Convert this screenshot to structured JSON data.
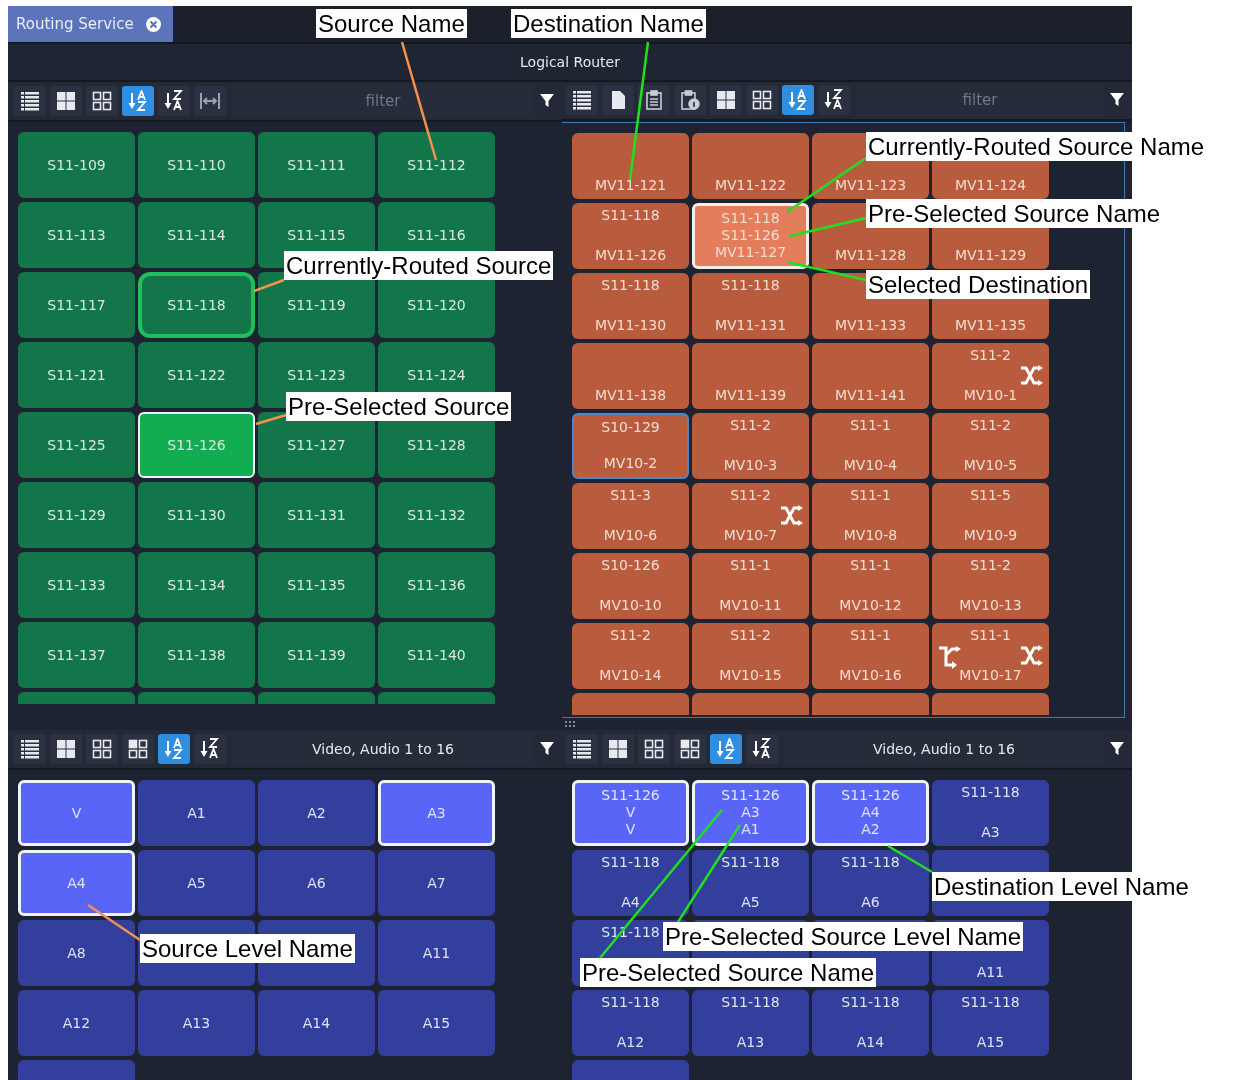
{
  "tab": {
    "label": "Routing Service",
    "selected": true
  },
  "header": {
    "title": "Logical Router"
  },
  "source_panel": {
    "toolbar": {
      "buttons": [
        {
          "kind": "list",
          "selected": false
        },
        {
          "kind": "grid-large",
          "selected": false
        },
        {
          "kind": "grid-small",
          "selected": false
        },
        {
          "kind": "sort-az",
          "selected": true
        },
        {
          "kind": "sort-za",
          "selected": false
        },
        {
          "kind": "fit-width",
          "selected": false
        }
      ],
      "filter": {
        "placeholder": "filter"
      }
    },
    "tiles": [
      {
        "name": "S11-109",
        "routed": false,
        "selected": false
      },
      {
        "name": "S11-110",
        "routed": false,
        "selected": false
      },
      {
        "name": "S11-111",
        "routed": false,
        "selected": false
      },
      {
        "name": "S11-112",
        "routed": false,
        "selected": false
      },
      {
        "name": "S11-113",
        "routed": false,
        "selected": false
      },
      {
        "name": "S11-114",
        "routed": false,
        "selected": false
      },
      {
        "name": "S11-115",
        "routed": false,
        "selected": false
      },
      {
        "name": "S11-116",
        "routed": false,
        "selected": false
      },
      {
        "name": "S11-117",
        "routed": false,
        "selected": false
      },
      {
        "name": "S11-118",
        "routed": true,
        "selected": false
      },
      {
        "name": "S11-119",
        "routed": false,
        "selected": false
      },
      {
        "name": "S11-120",
        "routed": false,
        "selected": false
      },
      {
        "name": "S11-121",
        "routed": false,
        "selected": false
      },
      {
        "name": "S11-122",
        "routed": false,
        "selected": false
      },
      {
        "name": "S11-123",
        "routed": false,
        "selected": false
      },
      {
        "name": "S11-124",
        "routed": false,
        "selected": false
      },
      {
        "name": "S11-125",
        "routed": false,
        "selected": false
      },
      {
        "name": "S11-126",
        "routed": false,
        "selected": true
      },
      {
        "name": "S11-127",
        "routed": false,
        "selected": false
      },
      {
        "name": "S11-128",
        "routed": false,
        "selected": false
      },
      {
        "name": "S11-129",
        "routed": false,
        "selected": false
      },
      {
        "name": "S11-130",
        "routed": false,
        "selected": false
      },
      {
        "name": "S11-131",
        "routed": false,
        "selected": false
      },
      {
        "name": "S11-132",
        "routed": false,
        "selected": false
      },
      {
        "name": "S11-133",
        "routed": false,
        "selected": false
      },
      {
        "name": "S11-134",
        "routed": false,
        "selected": false
      },
      {
        "name": "S11-135",
        "routed": false,
        "selected": false
      },
      {
        "name": "S11-136",
        "routed": false,
        "selected": false
      },
      {
        "name": "S11-137",
        "routed": false,
        "selected": false
      },
      {
        "name": "S11-138",
        "routed": false,
        "selected": false
      },
      {
        "name": "S11-139",
        "routed": false,
        "selected": false
      },
      {
        "name": "S11-140",
        "routed": false,
        "selected": false
      }
    ]
  },
  "destination_panel": {
    "toolbar": {
      "buttons": [
        {
          "kind": "list",
          "selected": false
        },
        {
          "kind": "page",
          "selected": false
        },
        {
          "kind": "clipboard",
          "selected": false
        },
        {
          "kind": "clipboard-info",
          "selected": false
        },
        {
          "kind": "grid-large",
          "selected": false
        },
        {
          "kind": "grid-small",
          "selected": false
        },
        {
          "kind": "sort-az",
          "selected": true
        },
        {
          "kind": "sort-za",
          "selected": false
        }
      ],
      "filter": {
        "placeholder": "filter"
      }
    },
    "tiles": [
      {
        "name": "MV11-121",
        "selected": false,
        "focused": false
      },
      {
        "name": "MV11-122",
        "selected": false,
        "focused": false
      },
      {
        "name": "MV11-123",
        "selected": false,
        "focused": false
      },
      {
        "name": "MV11-124",
        "selected": false,
        "focused": false
      },
      {
        "source": "S11-118",
        "name": "MV11-126",
        "selected": false,
        "focused": false
      },
      {
        "source": "S11-118",
        "preselect": "S11-126",
        "name": "MV11-127",
        "selected": true,
        "focused": false
      },
      {
        "name": "MV11-128",
        "selected": false,
        "focused": false
      },
      {
        "name": "MV11-129",
        "selected": false,
        "focused": false
      },
      {
        "source": "S11-118",
        "name": "MV11-130",
        "selected": false,
        "focused": false
      },
      {
        "source": "S11-118",
        "name": "MV11-131",
        "selected": false,
        "focused": false
      },
      {
        "name": "MV11-133",
        "selected": false,
        "focused": false
      },
      {
        "name": "MV11-135",
        "selected": false,
        "focused": false
      },
      {
        "name": "MV11-138",
        "selected": false,
        "focused": false
      },
      {
        "name": "MV11-139",
        "selected": false,
        "focused": false
      },
      {
        "name": "MV11-141",
        "selected": false,
        "focused": false
      },
      {
        "source": "S11-2",
        "name": "MV10-1",
        "selected": false,
        "focused": false,
        "crossover": true
      },
      {
        "source": "S10-129",
        "name": "MV10-2",
        "selected": false,
        "focused": true
      },
      {
        "source": "S11-2",
        "name": "MV10-3",
        "selected": false,
        "focused": false
      },
      {
        "source": "S11-1",
        "name": "MV10-4",
        "selected": false,
        "focused": false
      },
      {
        "source": "S11-2",
        "name": "MV10-5",
        "selected": false,
        "focused": false
      },
      {
        "source": "S11-3",
        "name": "MV10-6",
        "selected": false,
        "focused": false
      },
      {
        "source": "S11-2",
        "name": "MV10-7",
        "selected": false,
        "focused": false,
        "crossover": true
      },
      {
        "source": "S11-1",
        "name": "MV10-8",
        "selected": false,
        "focused": false
      },
      {
        "source": "S11-5",
        "name": "MV10-9",
        "selected": false,
        "focused": false
      },
      {
        "source": "S10-126",
        "name": "MV10-10",
        "selected": false,
        "focused": false
      },
      {
        "source": "S11-1",
        "name": "MV10-11",
        "selected": false,
        "focused": false
      },
      {
        "source": "S11-1",
        "name": "MV10-12",
        "selected": false,
        "focused": false
      },
      {
        "source": "S11-2",
        "name": "MV10-13",
        "selected": false,
        "focused": false
      },
      {
        "source": "S11-2",
        "name": "MV10-14",
        "selected": false,
        "focused": false
      },
      {
        "source": "S11-2",
        "name": "MV10-15",
        "selected": false,
        "focused": false
      },
      {
        "source": "S11-1",
        "name": "MV10-16",
        "selected": false,
        "focused": false
      },
      {
        "source": "S11-1",
        "name": "MV10-17",
        "selected": false,
        "focused": false,
        "tie_line": true,
        "crossover": true
      }
    ]
  },
  "source_levels": {
    "toolbar": {
      "buttons": [
        {
          "kind": "list",
          "selected": false
        },
        {
          "kind": "grid-large",
          "selected": false
        },
        {
          "kind": "grid-small",
          "selected": false
        },
        {
          "kind": "grid-alt",
          "selected": false
        },
        {
          "kind": "sort-az",
          "selected": true
        },
        {
          "kind": "sort-za",
          "selected": false
        }
      ],
      "filter": {
        "value": "Video, Audio 1 to 16"
      }
    },
    "tiles": [
      {
        "name": "V",
        "selected": true
      },
      {
        "name": "A1",
        "selected": false
      },
      {
        "name": "A2",
        "selected": false
      },
      {
        "name": "A3",
        "selected": true
      },
      {
        "name": "A4",
        "selected": true
      },
      {
        "name": "A5",
        "selected": false
      },
      {
        "name": "A6",
        "selected": false
      },
      {
        "name": "A7",
        "selected": false
      },
      {
        "name": "A8",
        "selected": false
      },
      {
        "selected": false
      },
      {
        "selected": false
      },
      {
        "name": "A11",
        "selected": false
      },
      {
        "name": "A12",
        "selected": false
      },
      {
        "name": "A13",
        "selected": false
      },
      {
        "name": "A14",
        "selected": false
      },
      {
        "name": "A15",
        "selected": false
      }
    ]
  },
  "destination_levels": {
    "toolbar": {
      "buttons": [
        {
          "kind": "list",
          "selected": false
        },
        {
          "kind": "grid-large",
          "selected": false
        },
        {
          "kind": "grid-small",
          "selected": false
        },
        {
          "kind": "grid-alt",
          "selected": false
        },
        {
          "kind": "sort-az",
          "selected": true
        },
        {
          "kind": "sort-za",
          "selected": false
        }
      ],
      "filter": {
        "value": "Video, Audio 1 to 16"
      }
    },
    "tiles": [
      {
        "source": "S11-126",
        "preselect": "V",
        "name": "V",
        "selected": true
      },
      {
        "source": "S11-126",
        "preselect": "A3",
        "name": "A1",
        "selected": true
      },
      {
        "source": "S11-126",
        "preselect": "A4",
        "name": "A2",
        "selected": true
      },
      {
        "source": "S11-118",
        "name": "A3",
        "selected": false
      },
      {
        "source": "S11-118",
        "name": "A4",
        "selected": false
      },
      {
        "source": "S11-118",
        "name": "A5",
        "selected": false
      },
      {
        "source": "S11-118",
        "name": "A6",
        "selected": false
      },
      {
        "selected": false
      },
      {
        "source": "S11-118",
        "selected": false
      },
      {
        "selected": false
      },
      {
        "selected": false
      },
      {
        "name": "A11",
        "selected": false
      },
      {
        "source": "S11-118",
        "name": "A12",
        "selected": false
      },
      {
        "source": "S11-118",
        "name": "A13",
        "selected": false
      },
      {
        "source": "S11-118",
        "name": "A14",
        "selected": false
      },
      {
        "source": "S11-118",
        "name": "A15",
        "selected": false
      }
    ]
  },
  "callouts": [
    {
      "text": "Source Name",
      "color": "#f5914e"
    },
    {
      "text": "Destination Name",
      "color": "#1ee01e"
    },
    {
      "text": "Currently-Routed Source Name",
      "color": "#1ee01e"
    },
    {
      "text": "Pre-Selected Source Name",
      "color": "#1ee01e"
    },
    {
      "text": "Selected Destination",
      "color": "#1ee01e"
    },
    {
      "text": "Currently-Routed Source",
      "color": "#f5914e"
    },
    {
      "text": "Pre-Selected Source",
      "color": "#f5914e"
    },
    {
      "text": "Destination Level Name",
      "color": "#1ee01e"
    },
    {
      "text": "Pre-Selected Source Level Name",
      "color": "#1ee01e"
    },
    {
      "text": "Pre-Selected Source Name",
      "color": "#1ee01e"
    },
    {
      "text": "Source Level Name",
      "color": "#f5914e"
    }
  ]
}
